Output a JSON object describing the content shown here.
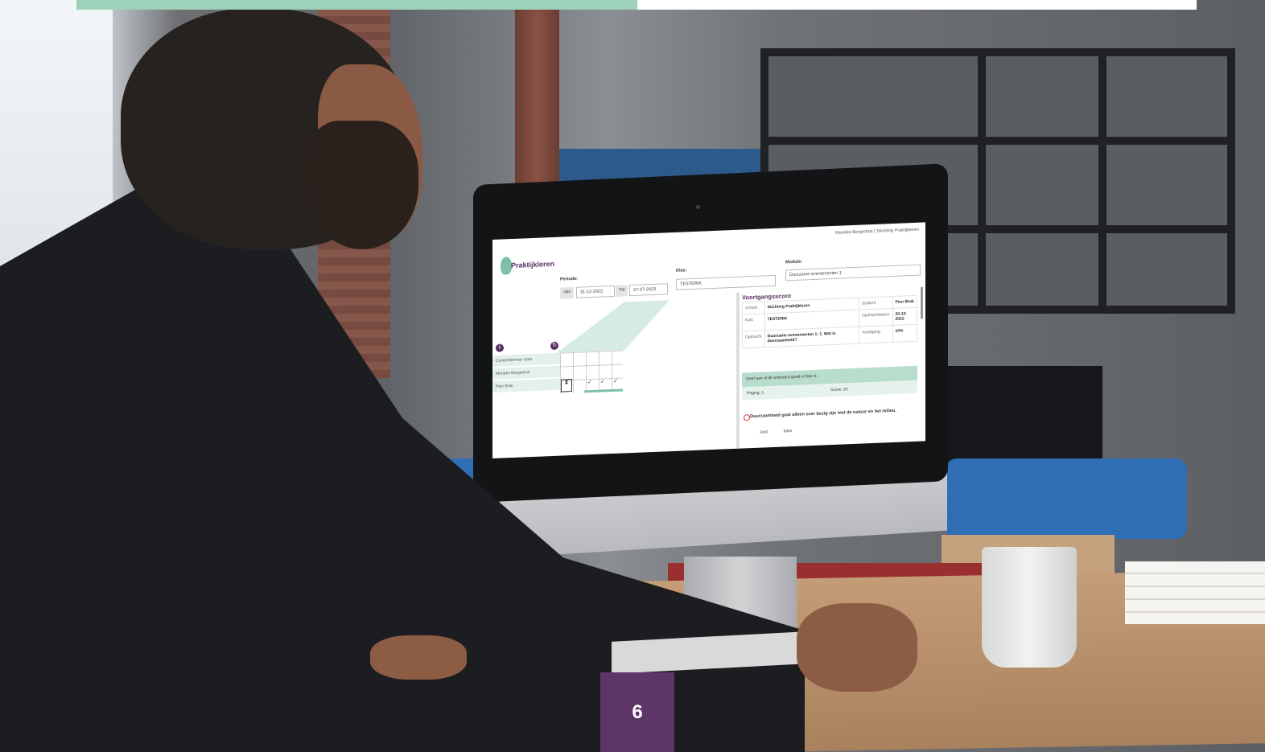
{
  "page_badge": "6",
  "colors": {
    "accent_green": "#9dd1ba",
    "accent_purple": "#5d3567"
  },
  "screen": {
    "user": "Marieke Bergerbos | Stichting Praktijkleren",
    "logo_text": "Praktijkleren",
    "periode_label": "Periode:",
    "van_label": "Van",
    "van_value": "31-12-2022",
    "tot_label": "Tot",
    "tot_value": "27-07-2023",
    "klas_label": "Klas:",
    "klas_value": "TESTERIK",
    "module_label": "Module:",
    "module_value": "Duurzame evenementen 1",
    "students": [
      "Contentbeheer Gast",
      "Marieke Bergerbos",
      "Pien Brok"
    ],
    "progress_title": "Voortgangsscore",
    "info": {
      "school_k": "School",
      "school_v": "Stichting Praktijkleren",
      "student_k": "Student",
      "student_v": "Pien Brok",
      "klas_k": "Klas",
      "klas_v": "TESTERIK",
      "datum_k": "Opdrachtdatum",
      "datum_v": "20-12-2022",
      "opdracht_k": "Opdracht",
      "opdracht_v": "Duurzame evenementen 1: 1. Wat is duurzaamheid?",
      "voortgang_k": "Voortgang",
      "voortgang_v": "10%"
    },
    "question_banner": "Geef aan of dit antwoord goed of fout is.",
    "poging": "Poging: 1",
    "score": "Score: 20",
    "answer": "Duurzaamheid gaat alleen over bezig zijn met de natuur en het milieu.",
    "juist_label": "Juist",
    "juist_value": "false"
  }
}
